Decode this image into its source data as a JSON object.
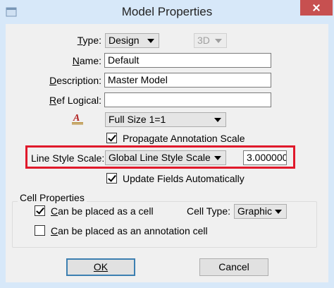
{
  "window": {
    "title": "Model Properties"
  },
  "form": {
    "type_label": "Type:",
    "type_value": "Design",
    "dim_value": "3D",
    "name_label": "Name:",
    "name_value": "Default",
    "description_label": "Description:",
    "description_value": "Master Model",
    "ref_logical_label": "Ref Logical:",
    "ref_logical_value": "",
    "annotation_scale_value": "Full Size 1=1",
    "propagate_label": "Propagate Annotation Scale",
    "propagate_checked": true,
    "line_style_scale_label": "Line Style Scale:",
    "line_style_scale_value": "Global Line Style Scale",
    "line_style_scale_factor": "3.000000",
    "update_fields_label": "Update Fields Automatically",
    "update_fields_checked": true
  },
  "cell_properties": {
    "group_title": "Cell Properties",
    "can_be_cell_label": "Can be placed as a cell",
    "can_be_cell_checked": true,
    "cell_type_label": "Cell Type:",
    "cell_type_value": "Graphic",
    "annotation_cell_label": "Can be placed as an annotation cell",
    "annotation_cell_checked": false
  },
  "buttons": {
    "ok_label": "OK",
    "cancel_label": "Cancel"
  },
  "colors": {
    "frame": "#d7e8f9",
    "dialog_bg": "#f0f0f0",
    "highlight": "#e0192b",
    "close_button": "#c75050"
  },
  "icons": {
    "annotation_scale": "annotation-scale-icon",
    "window_icon": "bentley-app-icon"
  }
}
